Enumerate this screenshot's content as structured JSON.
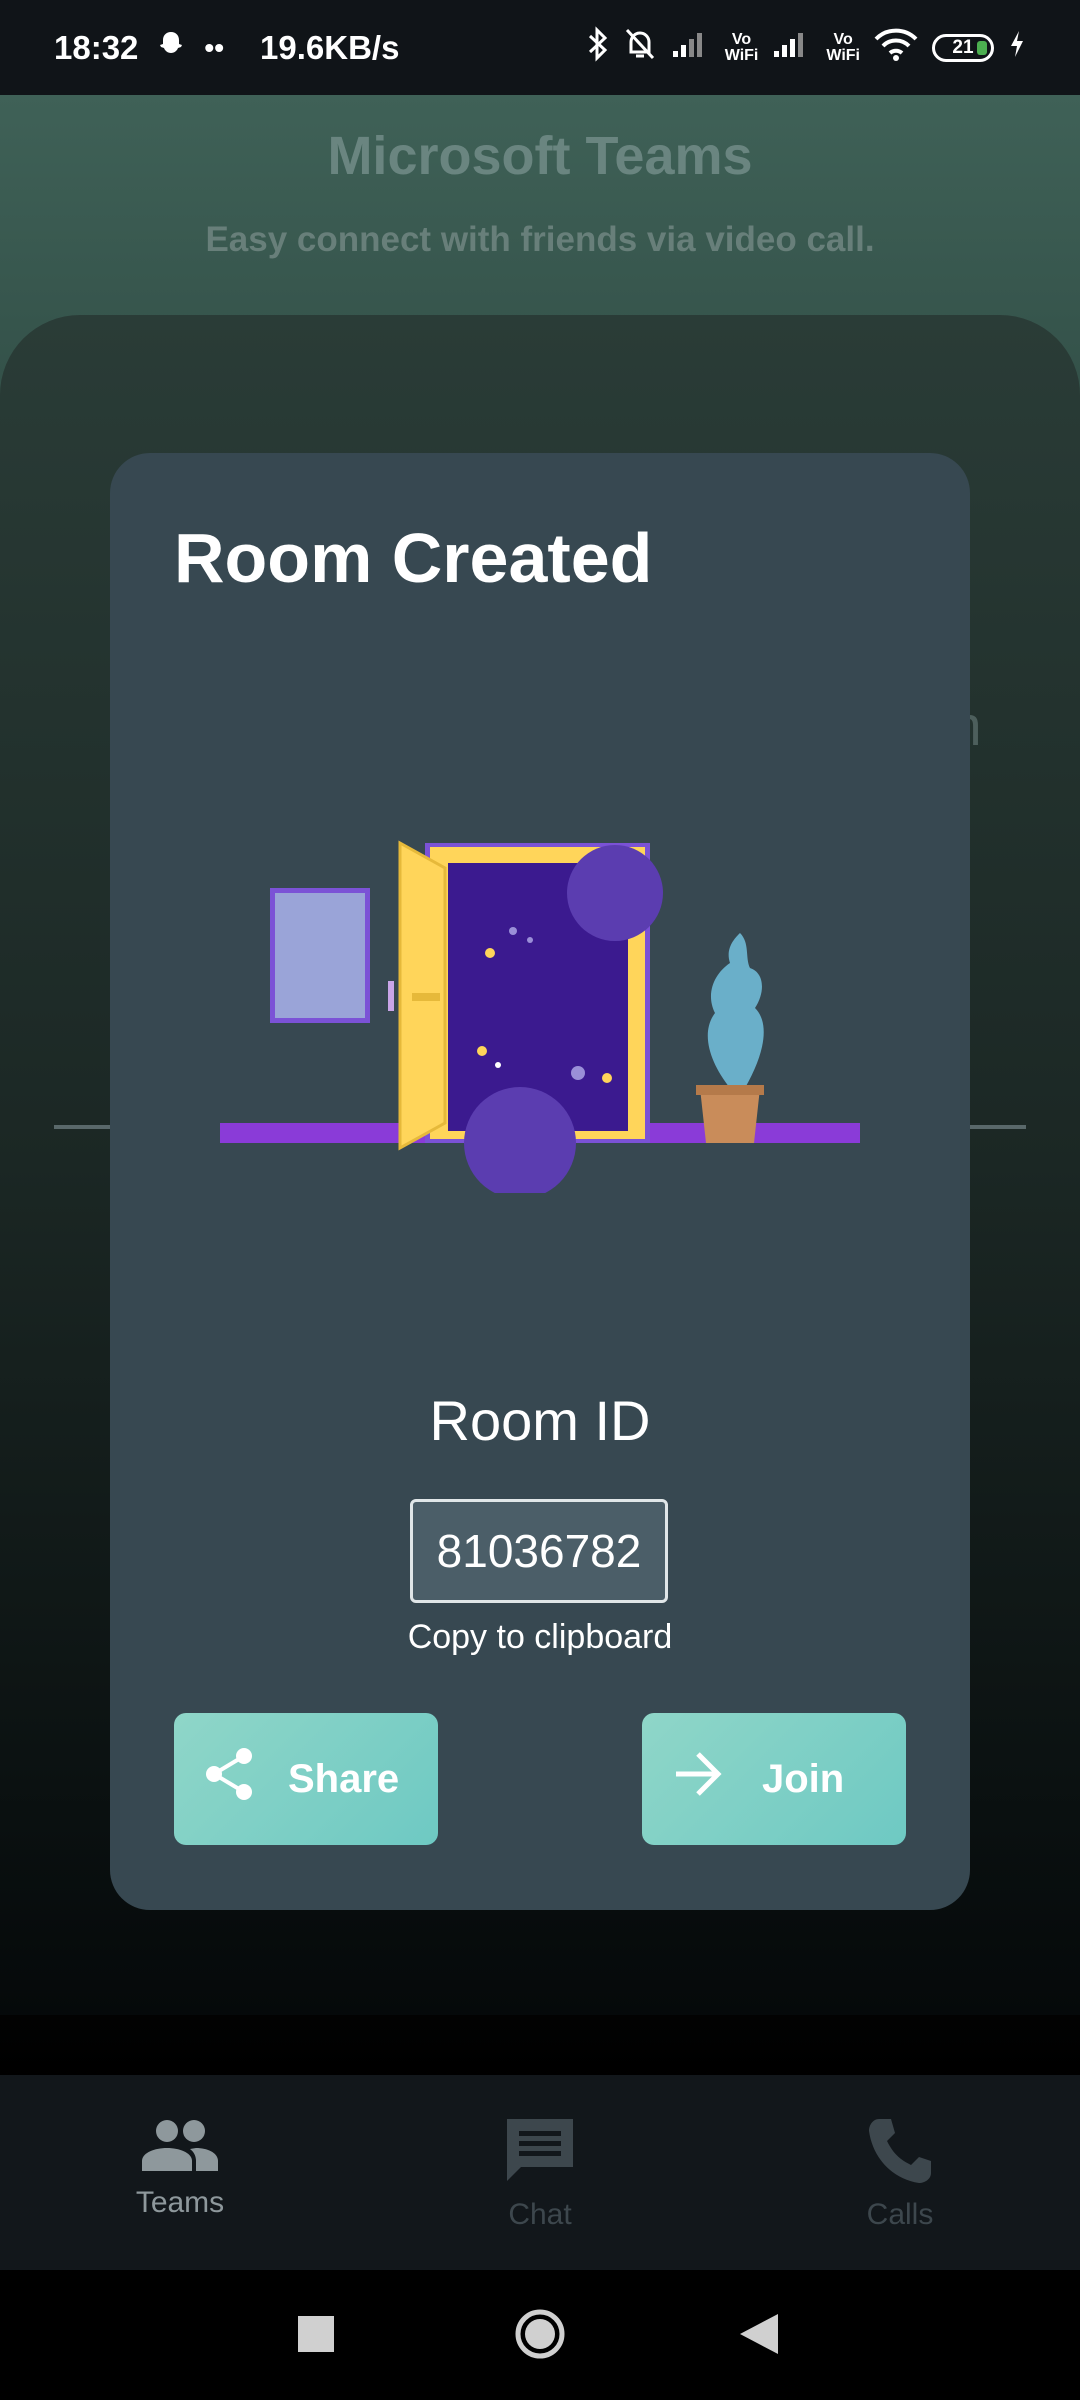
{
  "status_bar": {
    "time": "18:32",
    "speed": "19.6KB/s",
    "vowifi_1": "Vo\nWiFi",
    "vowifi_2": "Vo\nWiFi",
    "battery": "21"
  },
  "app": {
    "title": "Microsoft Teams",
    "subtitle": "Easy connect with friends via video call.",
    "background_fragment": "m"
  },
  "dialog": {
    "title": "Room Created",
    "room_id_label": "Room ID",
    "room_id": "81036782",
    "copy_label": "Copy to clipboard",
    "share_label": "Share",
    "join_label": "Join",
    "button_color": "#7fd0c6"
  },
  "bottom_nav": {
    "items": [
      {
        "label": "Teams",
        "icon": "people-icon"
      },
      {
        "label": "Chat",
        "icon": "chat-icon"
      },
      {
        "label": "Calls",
        "icon": "phone-icon"
      }
    ]
  }
}
